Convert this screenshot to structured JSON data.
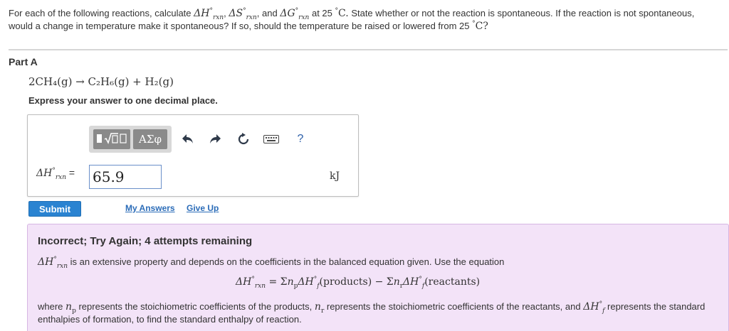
{
  "intro": {
    "text_a": "For each of the following reactions, calculate",
    "text_b": "and",
    "text_c": "at 25",
    "text_d": "State whether or not the reaction is spontaneous. If the reaction is not spontaneous, would a change in temperature make it spontaneous? If so, should the temperature be raised or lowered from 25",
    "text_e": "C?",
    "dh": "ΔH",
    "ds": "ΔS",
    "dg": "ΔG",
    "rxn": "rxn",
    "deg": "°",
    "celsius": "C."
  },
  "part": {
    "title": "Part A",
    "reaction": "2CH₄(g) → C₂H₆(g) + H₂(g)",
    "instruction": "Express your answer to one decimal place."
  },
  "toolbar": {
    "greek_label": "ΑΣφ",
    "template_icon": "template-icon",
    "undo_icon": "undo-icon",
    "redo_icon": "redo-icon",
    "reset_icon": "reset-icon",
    "keyboard_icon": "keyboard-icon",
    "help_label": "?"
  },
  "answer": {
    "label_symbol": "ΔH",
    "label_sup": "°",
    "label_sub": "rxn",
    "label_eq": "=",
    "value": "65.9",
    "unit": "kJ"
  },
  "actions": {
    "submit_label": "Submit",
    "my_answers_label": "My Answers",
    "give_up_label": "Give Up"
  },
  "feedback": {
    "title": "Incorrect; Try Again; 4 attempts remaining",
    "line1": "is an extensive property and depends on the coefficients in the balanced equation given. Use the equation",
    "eq_lhs": "ΔH",
    "eq_mid": "= Σ",
    "eq_np": "n",
    "eq_p": "p",
    "eq_dhf": "ΔH",
    "eq_f": "f",
    "eq_products": "(products) − Σ",
    "eq_nr": "n",
    "eq_r": "r",
    "eq_reactants": "(reactants)",
    "para_a": "where",
    "para_b": "represents the stoichiometric coefficients of the products,",
    "para_c": "represents the stoichiometric coefficients of the reactants, and",
    "para_d": "represents the standard enthalpies of formation, to find the standard enthalpy of reaction."
  },
  "colors": {
    "submit": "#2a83d1",
    "link": "#2b6cb8",
    "feedback_bg": "#f3e3f8",
    "toolbar_btn": "#8a8a8a"
  }
}
